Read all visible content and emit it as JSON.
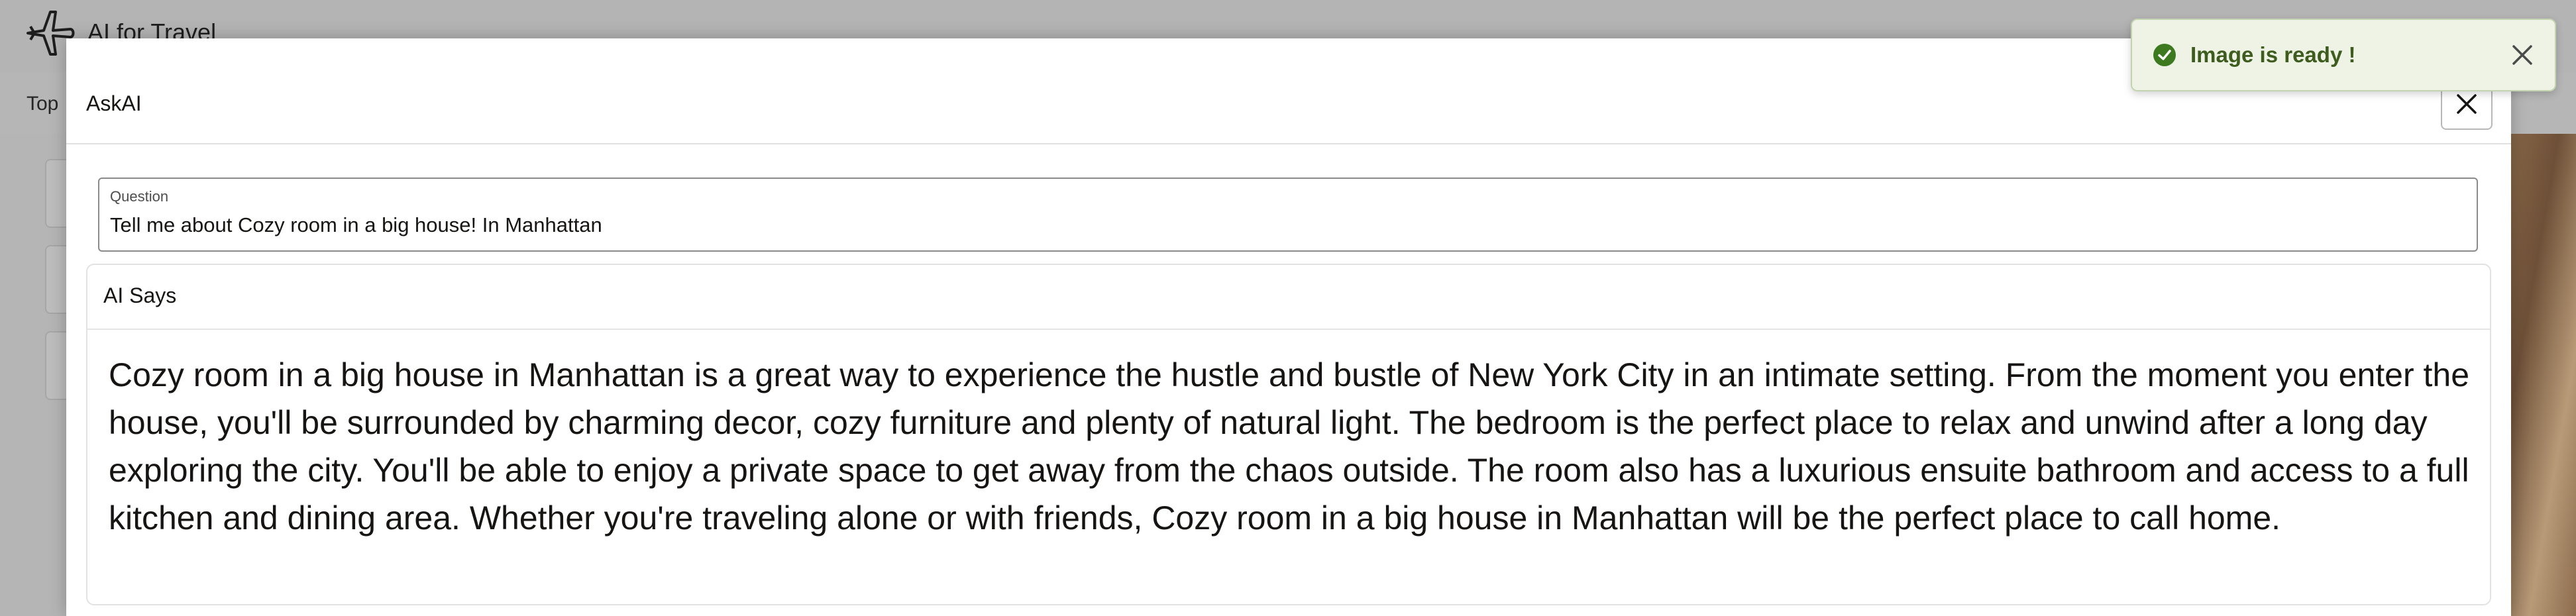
{
  "app": {
    "title": "AI for Travel",
    "nav_item": "Top"
  },
  "dialog": {
    "title": "AskAI",
    "question_label": "Question",
    "question_value": "Tell me about Cozy room in a big house! In Manhattan",
    "answer_title": "AI Says",
    "answer_text": "Cozy room in a big house in Manhattan is a great way to experience the hustle and bustle of New York City in an intimate setting. From the moment you enter the house, you'll be surrounded by charming decor, cozy furniture and plenty of natural light. The bedroom is the perfect place to relax and unwind after a long day exploring the city. You'll be able to enjoy a private space to get away from the chaos outside. The room also has a luxurious ensuite bathroom and access to a full kitchen and dining area. Whether you're traveling alone or with friends, Cozy room in a big house in Manhattan will be the perfect place to call home."
  },
  "toast": {
    "message": "Image is ready !",
    "accent_color": "#3d7a1f"
  },
  "icons": {
    "logo": "airplane-icon",
    "dialog_close": "close-icon",
    "toast_status": "check-circle-icon",
    "toast_close": "close-icon"
  }
}
